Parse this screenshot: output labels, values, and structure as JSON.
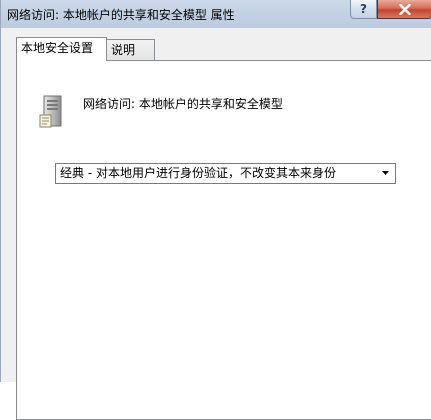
{
  "window": {
    "title": "网络访问: 本地帐户的共享和安全模型 属性",
    "help_label": "?"
  },
  "tabs": [
    {
      "label": "本地安全设置",
      "active": true
    },
    {
      "label": "说明",
      "active": false
    }
  ],
  "policy": {
    "name": "网络访问: 本地帐户的共享和安全模型",
    "icon": "server-icon"
  },
  "dropdown": {
    "selected": "经典 - 对本地用户进行身份验证，不改变其本来身份"
  }
}
